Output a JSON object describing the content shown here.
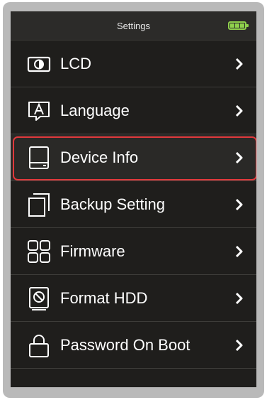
{
  "header": {
    "title": "Settings",
    "battery_icon": "battery-full-icon",
    "battery_color": "#8fd14c"
  },
  "menu": {
    "items": [
      {
        "label": "LCD",
        "icon": "display-brightness-icon"
      },
      {
        "label": "Language",
        "icon": "language-a-icon"
      },
      {
        "label": "Device Info",
        "icon": "device-icon",
        "selected": true
      },
      {
        "label": "Backup Setting",
        "icon": "backup-copy-icon"
      },
      {
        "label": "Firmware",
        "icon": "firmware-grid-icon"
      },
      {
        "label": "Format HDD",
        "icon": "format-hdd-icon"
      },
      {
        "label": "Password On Boot",
        "icon": "padlock-icon"
      }
    ],
    "chevron_icon": "chevron-right-icon"
  },
  "colors": {
    "screen_background": "#1f1e1c",
    "selection_outline": "#e0393c",
    "text": "#ffffff"
  }
}
